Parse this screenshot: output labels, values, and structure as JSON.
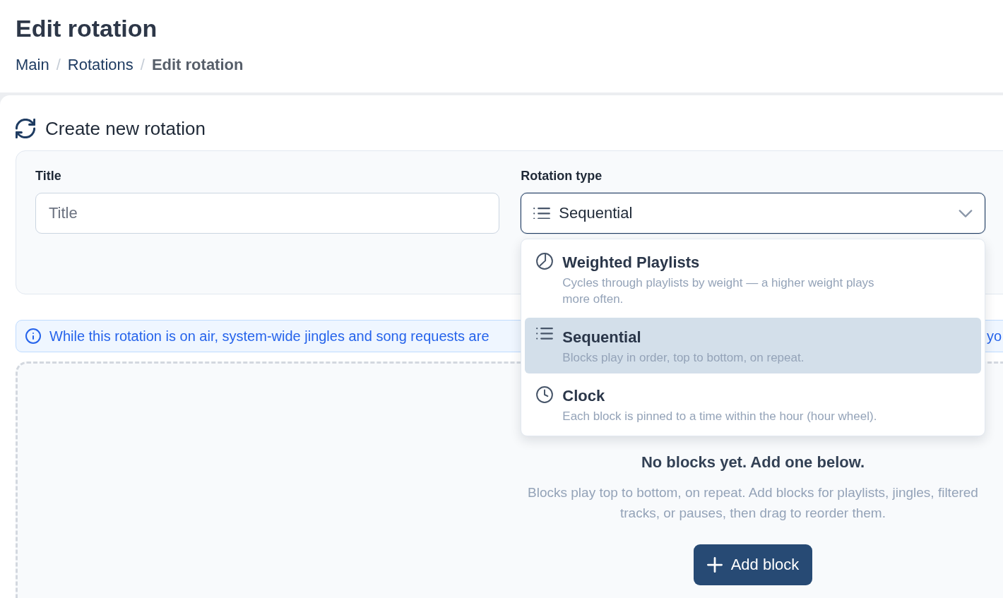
{
  "page_title": "Edit rotation",
  "breadcrumb": [
    {
      "kind": "link",
      "label": "Main"
    },
    {
      "kind": "separator",
      "label": "/"
    },
    {
      "kind": "link",
      "label": "Rotations"
    },
    {
      "kind": "separator",
      "label": "/"
    },
    {
      "kind": "current",
      "label": "Edit rotation"
    }
  ],
  "section_title": "Create new rotation",
  "fields": [
    {
      "kind": "text",
      "label": "Title",
      "placeholder": "Title"
    },
    {
      "kind": "select",
      "label": "Rotation type",
      "value": "Sequential",
      "expanded": true,
      "options": [
        {
          "kind": "weighted",
          "title": "Weighted Playlists",
          "description": "Cycles through playlists by weight — a higher weight plays more often.",
          "selected": false
        },
        {
          "kind": "sequential",
          "title": "Sequential",
          "description": "Blocks play in order, top to bottom, on repeat.",
          "selected": true
        },
        {
          "kind": "clock",
          "title": "Clock",
          "description": "Each block is pinned to a time within the hour (hour wheel).",
          "selected": false
        }
      ]
    }
  ],
  "notice": {
    "text_start": "While this rotation is on air, system-wide jingles and song requests are",
    "text_end": "yo"
  },
  "empty_state": {
    "title": "No blocks yet. Add one below.",
    "description": "Blocks play top to bottom, on repeat. Add blocks for playlists, jingles, filtered tracks, or pauses, then drag to reorder them.",
    "button": "Add block"
  }
}
